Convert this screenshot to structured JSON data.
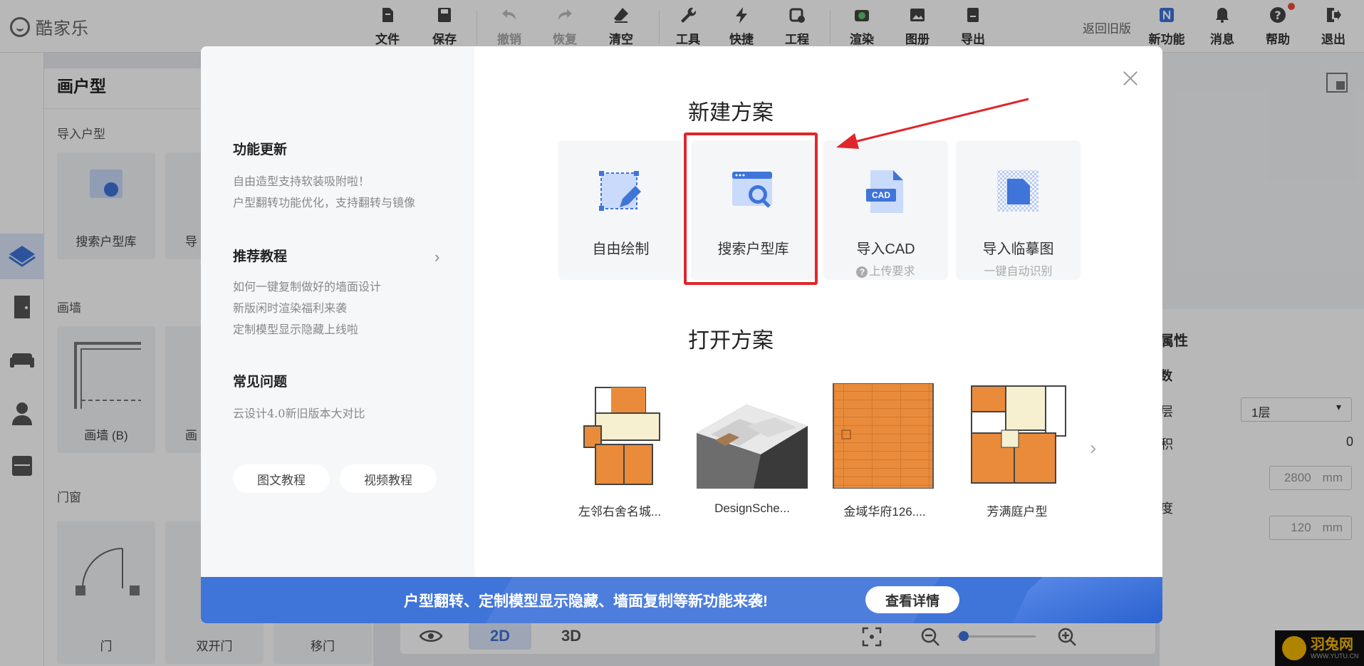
{
  "app": {
    "logo_text": "酷家乐",
    "back_old": "返回旧版"
  },
  "toolbar": [
    {
      "label": "文件",
      "icon": "file-icon"
    },
    {
      "label": "保存",
      "icon": "save-icon"
    },
    {
      "label": "撤销",
      "icon": "undo-icon"
    },
    {
      "label": "恢复",
      "icon": "redo-icon"
    },
    {
      "label": "清空",
      "icon": "eraser-icon"
    },
    {
      "label": "工具",
      "icon": "wrench-icon"
    },
    {
      "label": "快捷",
      "icon": "lightning-icon"
    },
    {
      "label": "工程",
      "icon": "project-icon"
    },
    {
      "label": "渲染",
      "icon": "camera-icon"
    },
    {
      "label": "图册",
      "icon": "album-icon"
    },
    {
      "label": "导出",
      "icon": "export-icon"
    }
  ],
  "toolbar_right": [
    {
      "label": "新功能",
      "icon": "new-feature-icon"
    },
    {
      "label": "消息",
      "icon": "bell-icon"
    },
    {
      "label": "帮助",
      "icon": "help-icon"
    },
    {
      "label": "退出",
      "icon": "exit-icon"
    }
  ],
  "panel": {
    "title": "画户型",
    "sections": [
      "导入户型",
      "画墙",
      "门窗"
    ],
    "cards": [
      "搜索户型库",
      "导",
      "画墙 (B)",
      "画",
      "门",
      "双开门",
      "移门"
    ]
  },
  "right_panel": {
    "title_fragment": "属性",
    "sub_fragment": "数",
    "rows": [
      "层",
      "积",
      "度"
    ],
    "floor_select": "1层",
    "area_value": "0",
    "height_value": "2800",
    "thickness_value": "120",
    "unit": "mm"
  },
  "bottom": {
    "view_2d": "2D",
    "view_3d": "3D"
  },
  "watermark": {
    "title": "羽兔网",
    "url": "WWW.YUTU.CN"
  },
  "modal": {
    "left": {
      "updates_title": "功能更新",
      "updates": [
        "自由造型支持软装吸附啦！",
        "户型翻转功能优化，支持翻转与镜像"
      ],
      "tutorials_title": "推荐教程",
      "tutorials": [
        "如何一键复制做好的墙面设计",
        "新版闲时渲染福利来袭",
        "定制模型显示隐藏上线啦"
      ],
      "faq_title": "常见问题",
      "faq": [
        "云设计4.0新旧版本大对比"
      ],
      "btn_text_tutorial": "图文教程",
      "btn_video_tutorial": "视频教程"
    },
    "new_title": "新建方案",
    "new_cards": [
      {
        "label": "自由绘制",
        "sub": ""
      },
      {
        "label": "搜索户型库",
        "sub": ""
      },
      {
        "label": "导入CAD",
        "sub": "上传要求",
        "badge": "CAD"
      },
      {
        "label": "导入临摹图",
        "sub": "一键自动识别"
      }
    ],
    "open_title": "打开方案",
    "open_cards": [
      "左邻右舍名城...",
      "DesignSche...",
      "金域华府126....",
      "芳满庭户型"
    ],
    "banner_text": "户型翻转、定制模型显示隐藏、墙面复制等新功能来袭!",
    "banner_button": "查看详情"
  },
  "colors": {
    "accent": "#3f74d9",
    "highlight": "#e0262b",
    "floor_orange": "#e98b3a"
  }
}
